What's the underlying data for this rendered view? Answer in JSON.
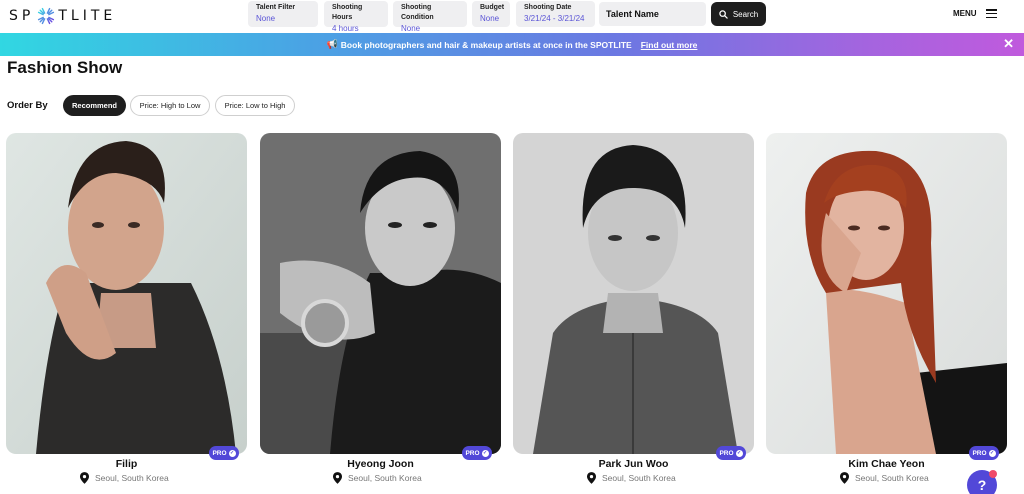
{
  "header": {
    "logo_left": "SP",
    "logo_right": "TLITE",
    "filters": [
      {
        "title": "Talent Filter",
        "value": "None"
      },
      {
        "title": "Shooting Hours",
        "value": "4 hours"
      },
      {
        "title": "Shooting Condition",
        "value": "None"
      },
      {
        "title": "Budget",
        "value": "None"
      },
      {
        "title": "Shooting Date",
        "value": "3/21/24 - 3/21/24"
      }
    ],
    "talent_name_placeholder": "Talent Name",
    "search_label": "Search",
    "menu_label": "MENU"
  },
  "banner": {
    "text": "Book photographers and hair & makeup artists at once in the SPOTLITE",
    "link": "Find out more",
    "close": "✕"
  },
  "page": {
    "title": "Fashion Show",
    "order_by_label": "Order By",
    "sort_options": [
      "Recommend",
      "Price: High to Low",
      "Price: Low to High"
    ],
    "active_sort": "Recommend"
  },
  "talents": [
    {
      "name": "Filip",
      "location": "Seoul, South Korea",
      "badge": "PRO"
    },
    {
      "name": "Hyeong Joon",
      "location": "Seoul, South Korea",
      "badge": "PRO"
    },
    {
      "name": "Park Jun Woo",
      "location": "Seoul, South Korea",
      "badge": "PRO"
    },
    {
      "name": "Kim Chae Yeon",
      "location": "Seoul, South Korea",
      "badge": "PRO"
    }
  ],
  "colors": {
    "accent": "#5248d8",
    "filter_value": "#5b55d6",
    "dark_button": "#1e1e1e"
  },
  "icons": [
    "star-logo-icon",
    "search-icon",
    "menu-icon",
    "megaphone-icon",
    "close-icon",
    "location-pin-icon",
    "verified-check-icon",
    "help-icon"
  ]
}
